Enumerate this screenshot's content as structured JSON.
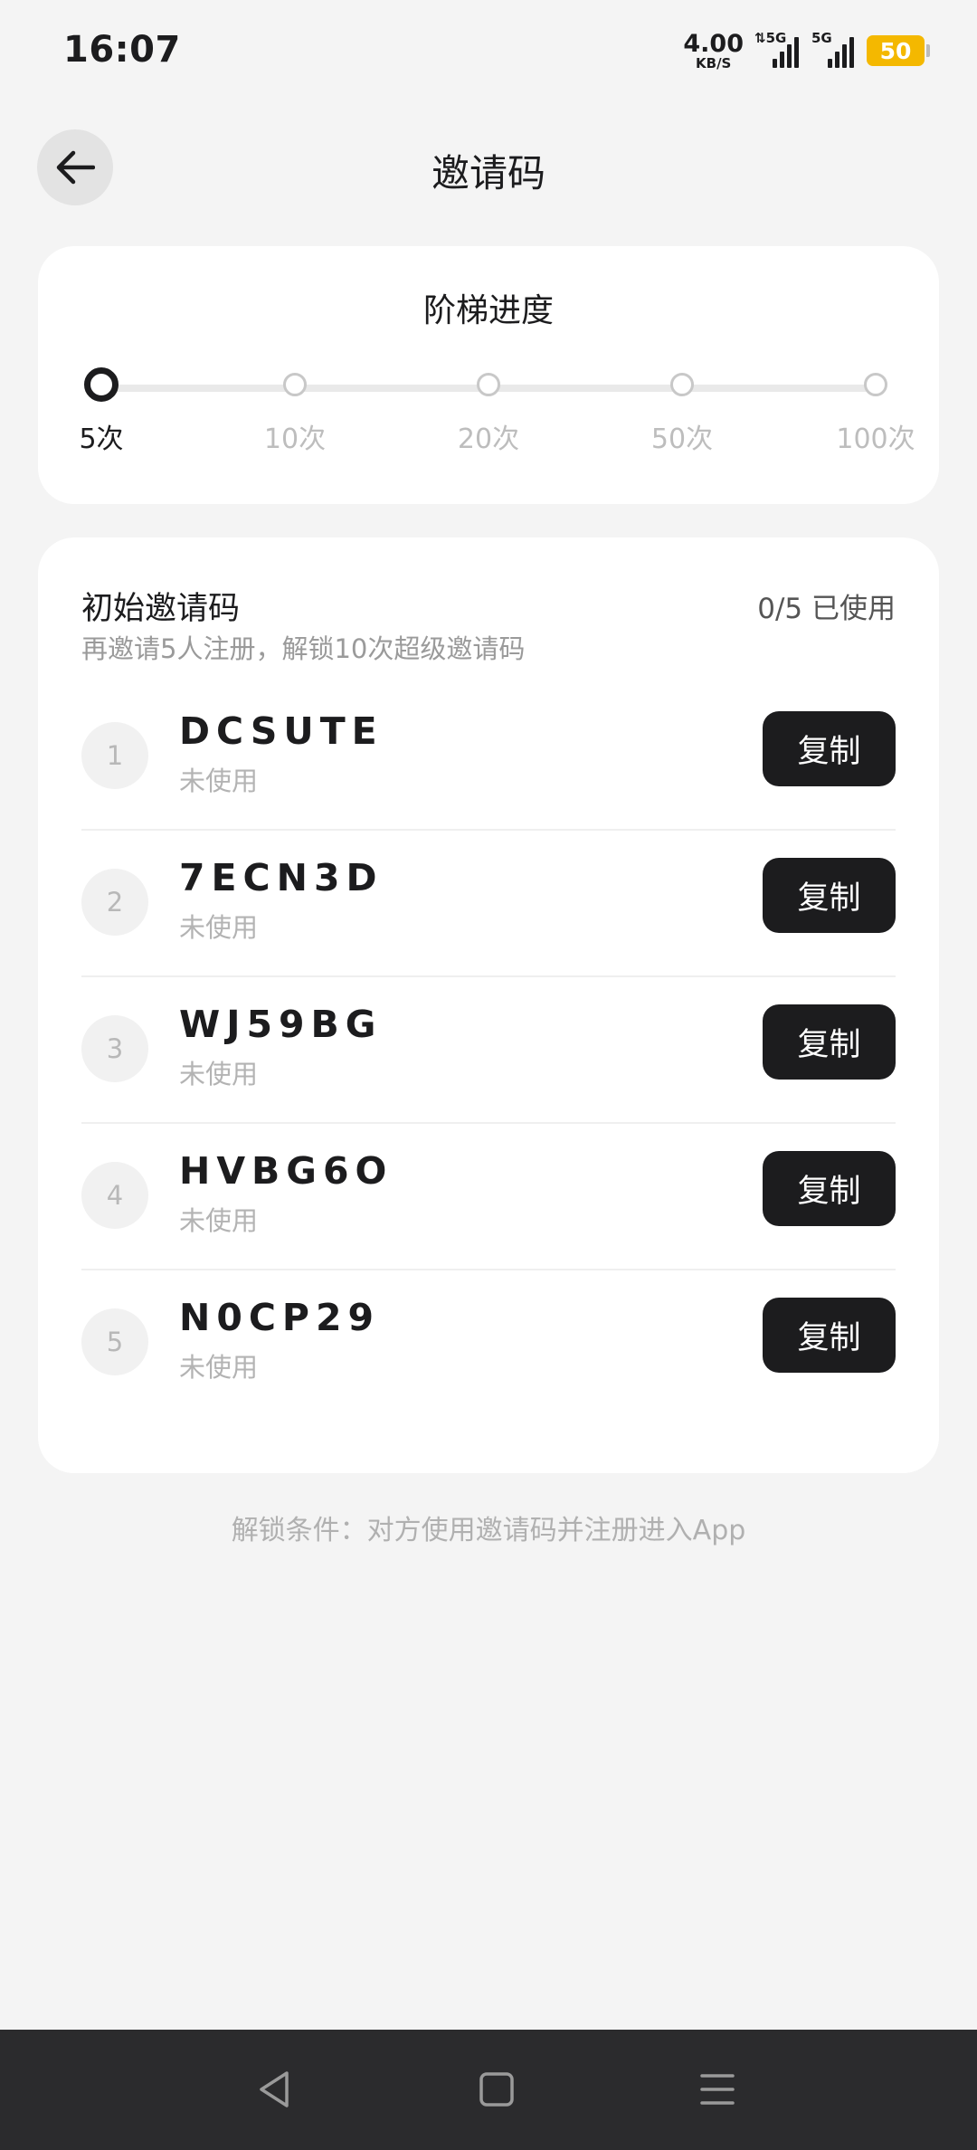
{
  "status_bar": {
    "time": "16:07",
    "net_speed": "4.00",
    "net_unit": "KB/S",
    "signal1_label": "5G",
    "signal2_label": "5G",
    "battery": "50",
    "battery_color": "#f4b800"
  },
  "header": {
    "title": "邀请码",
    "back_icon": "arrow-left-icon"
  },
  "progress": {
    "title": "阶梯进度",
    "current_step": 0,
    "steps": [
      "5次",
      "10次",
      "20次",
      "50次",
      "100次"
    ]
  },
  "codes_section": {
    "title": "初始邀请码",
    "usage": "0/5 已使用",
    "description": "再邀请5人注册，解锁10次超级邀请码",
    "copy_label": "复制",
    "codes": [
      {
        "index": "1",
        "code": "DCSUTE",
        "status": "未使用"
      },
      {
        "index": "2",
        "code": "7ECN3D",
        "status": "未使用"
      },
      {
        "index": "3",
        "code": "WJ59BG",
        "status": "未使用"
      },
      {
        "index": "4",
        "code": "HVBG6O",
        "status": "未使用"
      },
      {
        "index": "5",
        "code": "N0CP29",
        "status": "未使用"
      }
    ]
  },
  "footer_note": "解锁条件：对方使用邀请码并注册进入App",
  "nav_bar": {
    "back_icon": "triangle-back-icon",
    "home_icon": "square-home-icon",
    "menu_icon": "menu-lines-icon"
  },
  "colors": {
    "background": "#f4f4f4",
    "accent_dark": "#1c1c1e",
    "muted": "#b3b3b3"
  }
}
